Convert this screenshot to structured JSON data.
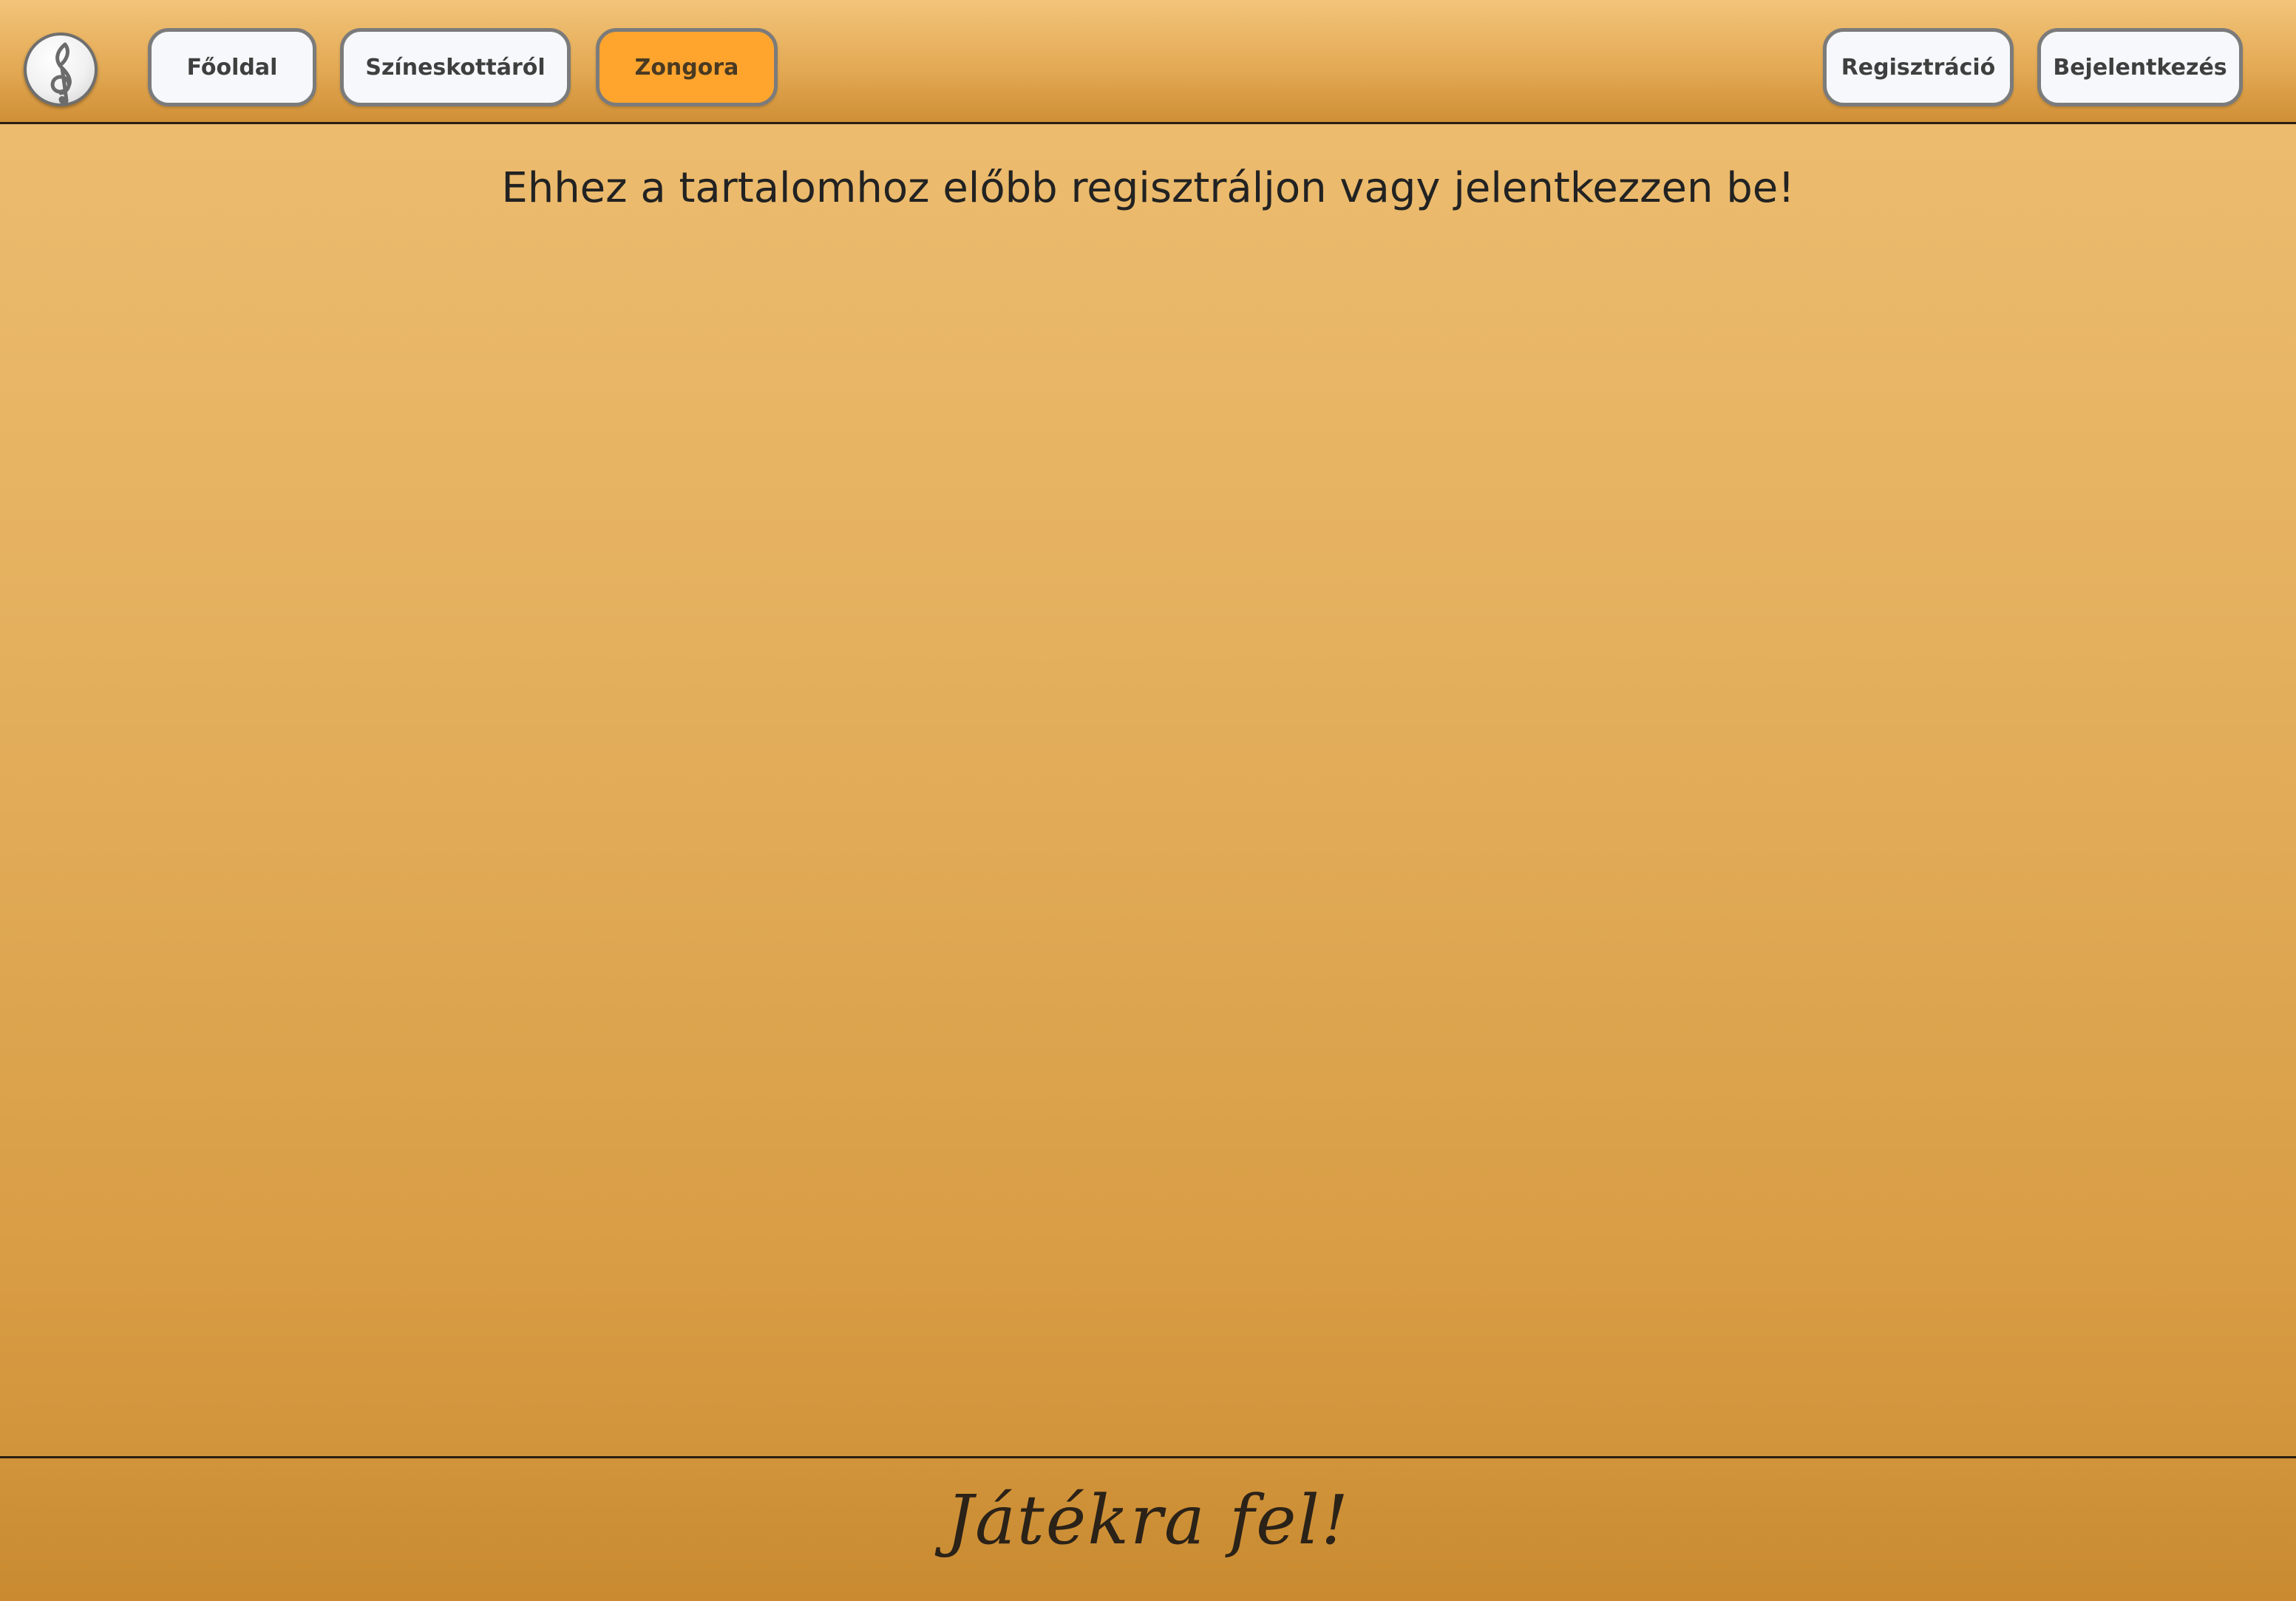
{
  "header": {
    "logo_icon": "treble-clef-icon",
    "nav": {
      "home_label": "Főoldal",
      "about_label": "Színeskottáról",
      "piano_label": "Zongora"
    },
    "auth": {
      "register_label": "Regisztráció",
      "login_label": "Bejelentkezés"
    },
    "active_item": "Zongora"
  },
  "main": {
    "message": "Ehhez a tartalomhoz előbb regisztráljon vagy jelentkezzen be!"
  },
  "footer": {
    "tagline": "Játékra fel!"
  },
  "colors": {
    "active_button": "#ffa52e",
    "button_background": "#f7f8fb",
    "button_border": "#7b7b7b",
    "text": "#222222"
  }
}
